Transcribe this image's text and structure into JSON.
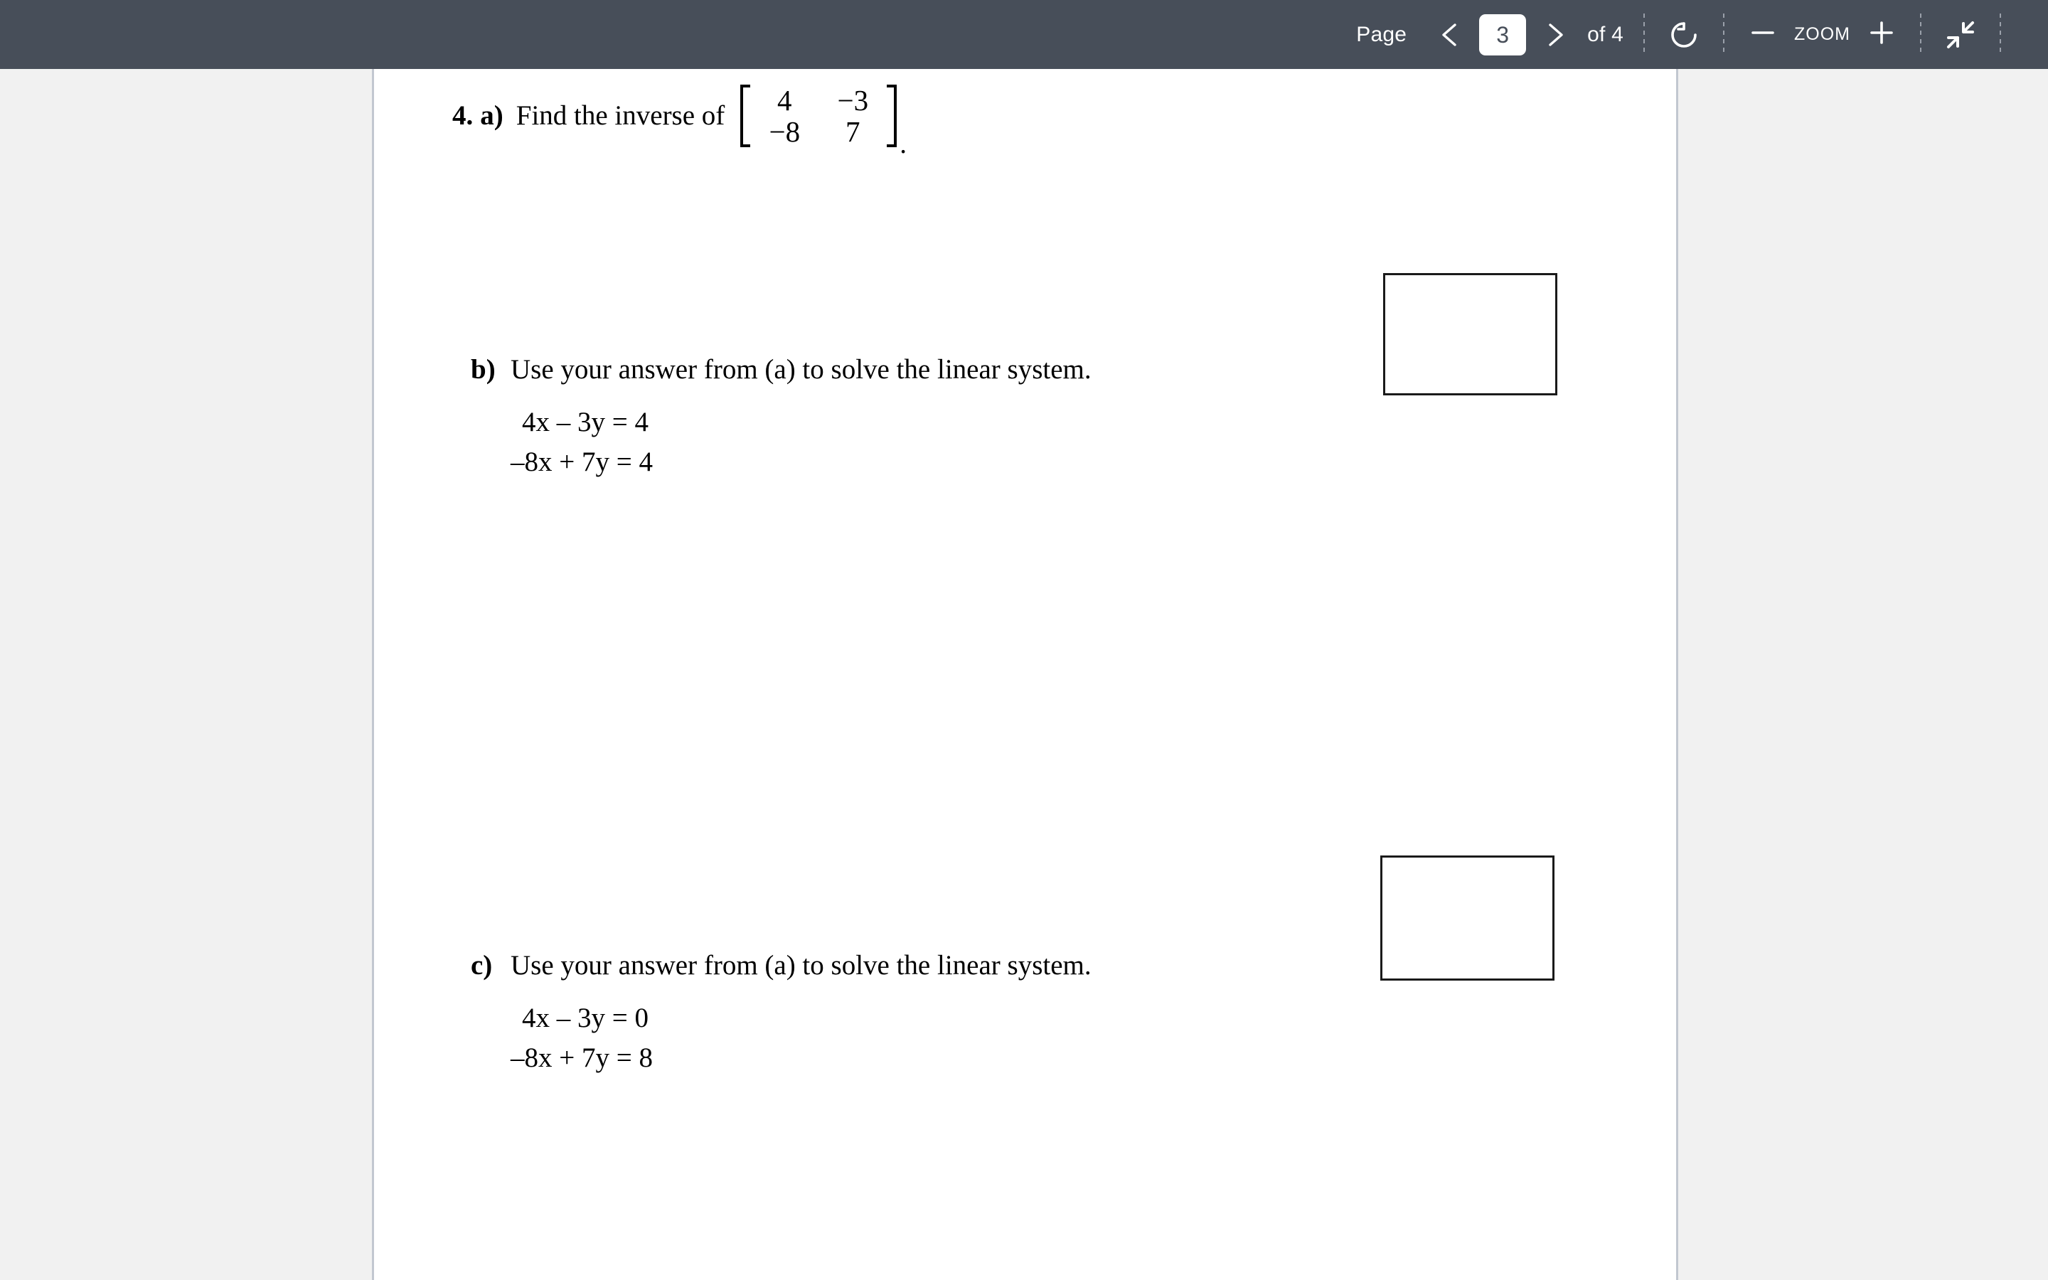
{
  "toolbar": {
    "page_label": "Page",
    "prev_icon": "chevron-left-icon",
    "current_page": "3",
    "next_icon": "chevron-right-icon",
    "of_label": "of 4",
    "total_pages": "4",
    "rotate_icon": "rotate-icon",
    "zoom_out_label": "—",
    "zoom_label": "ZOOM",
    "zoom_in_label": "+",
    "fullscreen_exit_icon": "collapse-icon",
    "background_color": "#474e59",
    "text_color": "#ffffff"
  },
  "document": {
    "question": {
      "number": "4.",
      "part_a_letter": "a)",
      "part_a_text": "Find the inverse of",
      "matrix": {
        "rows": [
          [
            "4",
            "−3"
          ],
          [
            "−8",
            "7"
          ]
        ]
      },
      "trailing_punctuation": "."
    },
    "parts": [
      {
        "letter": "b)",
        "text": "Use your answer from (a) to solve the linear system.",
        "equations": [
          "4x – 3y = 4",
          "–8x + 7y = 4"
        ]
      },
      {
        "letter": "c)",
        "text": "Use your answer from (a) to solve the linear system.",
        "equations": [
          "4x – 3y = 0",
          "–8x + 7y = 8"
        ]
      }
    ],
    "answer_boxes": [
      {
        "name": "answer-box-a",
        "value": ""
      },
      {
        "name": "answer-box-b",
        "value": ""
      }
    ],
    "page_background": "#ffffff",
    "viewer_background": "#f1f1f1"
  }
}
